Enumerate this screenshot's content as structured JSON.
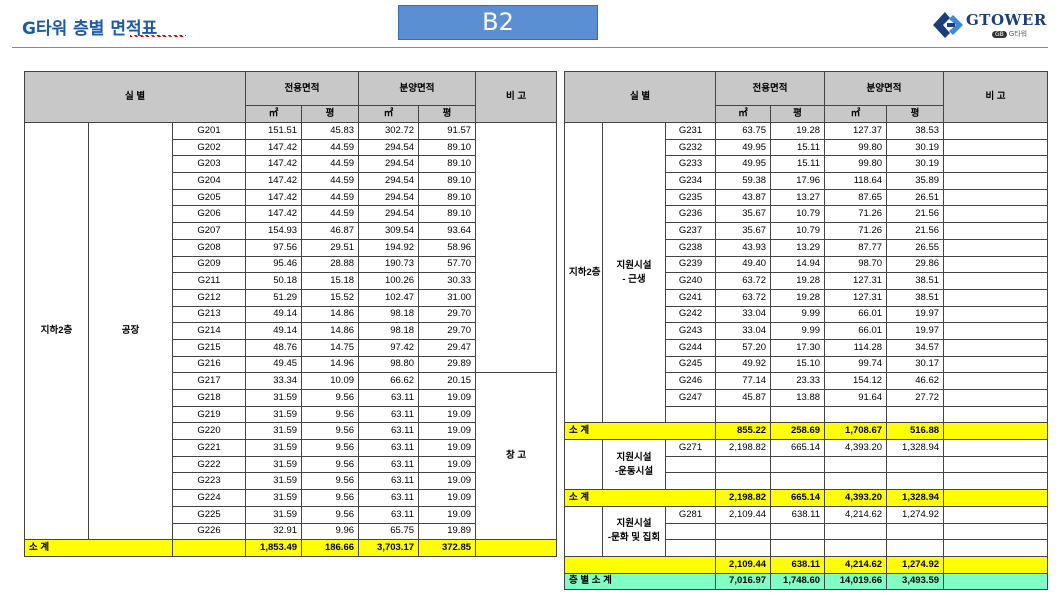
{
  "header": {
    "title": "G타워 층별 면적표",
    "floor_badge": "B2",
    "logo_text": "GTOWER",
    "logo_sub_badge": "GB",
    "logo_sub": "G타워"
  },
  "left_table": {
    "headers": {
      "room": "실        별",
      "exclusive": "전용면적",
      "sale": "분양면적",
      "note": "비  고",
      "sqm": "㎡",
      "pyeong": "평",
      "sqm2": "㎡",
      "pyeong2": "평"
    },
    "floor_label": "지하2층",
    "group_label": "공장",
    "note_storage": "창  고",
    "rows": [
      {
        "code": "G201",
        "ex_m2": "151.51",
        "ex_py": "45.83",
        "sa_m2": "302.72",
        "sa_py": "91.57"
      },
      {
        "code": "G202",
        "ex_m2": "147.42",
        "ex_py": "44.59",
        "sa_m2": "294.54",
        "sa_py": "89.10"
      },
      {
        "code": "G203",
        "ex_m2": "147.42",
        "ex_py": "44.59",
        "sa_m2": "294.54",
        "sa_py": "89.10"
      },
      {
        "code": "G204",
        "ex_m2": "147.42",
        "ex_py": "44.59",
        "sa_m2": "294.54",
        "sa_py": "89.10"
      },
      {
        "code": "G205",
        "ex_m2": "147.42",
        "ex_py": "44.59",
        "sa_m2": "294.54",
        "sa_py": "89.10"
      },
      {
        "code": "G206",
        "ex_m2": "147.42",
        "ex_py": "44.59",
        "sa_m2": "294.54",
        "sa_py": "89.10"
      },
      {
        "code": "G207",
        "ex_m2": "154.93",
        "ex_py": "46.87",
        "sa_m2": "309.54",
        "sa_py": "93.64"
      },
      {
        "code": "G208",
        "ex_m2": "97.56",
        "ex_py": "29.51",
        "sa_m2": "194.92",
        "sa_py": "58.96"
      },
      {
        "code": "G209",
        "ex_m2": "95.46",
        "ex_py": "28.88",
        "sa_m2": "190.73",
        "sa_py": "57.70"
      },
      {
        "code": "G211",
        "ex_m2": "50.18",
        "ex_py": "15.18",
        "sa_m2": "100.26",
        "sa_py": "30.33"
      },
      {
        "code": "G212",
        "ex_m2": "51.29",
        "ex_py": "15.52",
        "sa_m2": "102.47",
        "sa_py": "31.00"
      },
      {
        "code": "G213",
        "ex_m2": "49.14",
        "ex_py": "14.86",
        "sa_m2": "98.18",
        "sa_py": "29.70"
      },
      {
        "code": "G214",
        "ex_m2": "49.14",
        "ex_py": "14.86",
        "sa_m2": "98.18",
        "sa_py": "29.70"
      },
      {
        "code": "G215",
        "ex_m2": "48.76",
        "ex_py": "14.75",
        "sa_m2": "97.42",
        "sa_py": "29.47"
      },
      {
        "code": "G216",
        "ex_m2": "49.45",
        "ex_py": "14.96",
        "sa_m2": "98.80",
        "sa_py": "29.89"
      },
      {
        "code": "G217",
        "ex_m2": "33.34",
        "ex_py": "10.09",
        "sa_m2": "66.62",
        "sa_py": "20.15"
      },
      {
        "code": "G218",
        "ex_m2": "31.59",
        "ex_py": "9.56",
        "sa_m2": "63.11",
        "sa_py": "19.09"
      },
      {
        "code": "G219",
        "ex_m2": "31.59",
        "ex_py": "9.56",
        "sa_m2": "63.11",
        "sa_py": "19.09"
      },
      {
        "code": "G220",
        "ex_m2": "31.59",
        "ex_py": "9.56",
        "sa_m2": "63.11",
        "sa_py": "19.09"
      },
      {
        "code": "G221",
        "ex_m2": "31.59",
        "ex_py": "9.56",
        "sa_m2": "63.11",
        "sa_py": "19.09"
      },
      {
        "code": "G222",
        "ex_m2": "31.59",
        "ex_py": "9.56",
        "sa_m2": "63.11",
        "sa_py": "19.09"
      },
      {
        "code": "G223",
        "ex_m2": "31.59",
        "ex_py": "9.56",
        "sa_m2": "63.11",
        "sa_py": "19.09"
      },
      {
        "code": "G224",
        "ex_m2": "31.59",
        "ex_py": "9.56",
        "sa_m2": "63.11",
        "sa_py": "19.09"
      },
      {
        "code": "G225",
        "ex_m2": "31.59",
        "ex_py": "9.56",
        "sa_m2": "63.11",
        "sa_py": "19.09"
      },
      {
        "code": "G226",
        "ex_m2": "32.91",
        "ex_py": "9.96",
        "sa_m2": "65.75",
        "sa_py": "19.89"
      }
    ],
    "subtotal": {
      "label": "소  계",
      "ex_m2": "1,853.49",
      "ex_py": "186.66",
      "sa_m2": "3,703.17",
      "sa_py": "372.85"
    }
  },
  "right_table": {
    "headers": {
      "room": "실        별",
      "exclusive": "전용면적",
      "sale": "분양면적",
      "note": "비  고",
      "sqm": "㎡",
      "pyeong": "평",
      "sqm2": "㎡",
      "pyeong2": "평"
    },
    "floor_label": "지하2층",
    "group1_label": "지원시설\n- 근생",
    "group1_rows": [
      {
        "code": "G231",
        "ex_m2": "63.75",
        "ex_py": "19.28",
        "sa_m2": "127.37",
        "sa_py": "38.53"
      },
      {
        "code": "G232",
        "ex_m2": "49.95",
        "ex_py": "15.11",
        "sa_m2": "99.80",
        "sa_py": "30.19"
      },
      {
        "code": "G233",
        "ex_m2": "49.95",
        "ex_py": "15.11",
        "sa_m2": "99.80",
        "sa_py": "30.19"
      },
      {
        "code": "G234",
        "ex_m2": "59.38",
        "ex_py": "17.96",
        "sa_m2": "118.64",
        "sa_py": "35.89"
      },
      {
        "code": "G235",
        "ex_m2": "43.87",
        "ex_py": "13.27",
        "sa_m2": "87.65",
        "sa_py": "26.51"
      },
      {
        "code": "G236",
        "ex_m2": "35.67",
        "ex_py": "10.79",
        "sa_m2": "71.26",
        "sa_py": "21.56"
      },
      {
        "code": "G237",
        "ex_m2": "35.67",
        "ex_py": "10.79",
        "sa_m2": "71.26",
        "sa_py": "21.56"
      },
      {
        "code": "G238",
        "ex_m2": "43.93",
        "ex_py": "13.29",
        "sa_m2": "87.77",
        "sa_py": "26.55"
      },
      {
        "code": "G239",
        "ex_m2": "49.40",
        "ex_py": "14.94",
        "sa_m2": "98.70",
        "sa_py": "29.86"
      },
      {
        "code": "G240",
        "ex_m2": "63.72",
        "ex_py": "19.28",
        "sa_m2": "127.31",
        "sa_py": "38.51"
      },
      {
        "code": "G241",
        "ex_m2": "63.72",
        "ex_py": "19.28",
        "sa_m2": "127.31",
        "sa_py": "38.51"
      },
      {
        "code": "G242",
        "ex_m2": "33.04",
        "ex_py": "9.99",
        "sa_m2": "66.01",
        "sa_py": "19.97"
      },
      {
        "code": "G243",
        "ex_m2": "33.04",
        "ex_py": "9.99",
        "sa_m2": "66.01",
        "sa_py": "19.97"
      },
      {
        "code": "G244",
        "ex_m2": "57.20",
        "ex_py": "17.30",
        "sa_m2": "114.28",
        "sa_py": "34.57"
      },
      {
        "code": "G245",
        "ex_m2": "49.92",
        "ex_py": "15.10",
        "sa_m2": "99.74",
        "sa_py": "30.17"
      },
      {
        "code": "G246",
        "ex_m2": "77.14",
        "ex_py": "23.33",
        "sa_m2": "154.12",
        "sa_py": "46.62"
      },
      {
        "code": "G247",
        "ex_m2": "45.87",
        "ex_py": "13.88",
        "sa_m2": "91.64",
        "sa_py": "27.72"
      }
    ],
    "subtotal1": {
      "label": "소  계",
      "ex_m2": "855.22",
      "ex_py": "258.69",
      "sa_m2": "1,708.67",
      "sa_py": "516.88"
    },
    "group2_label": "지원시설\n-운동시설",
    "group2_row": {
      "code": "G271",
      "ex_m2": "2,198.82",
      "ex_py": "665.14",
      "sa_m2": "4,393.20",
      "sa_py": "1,328.94"
    },
    "subtotal2": {
      "label": "소  계",
      "ex_m2": "2,198.82",
      "ex_py": "665.14",
      "sa_m2": "4,393.20",
      "sa_py": "1,328.94"
    },
    "group3_label": "지원시설\n-문화 및 집회",
    "group3_row": {
      "code": "G281",
      "ex_m2": "2,109.44",
      "ex_py": "638.11",
      "sa_m2": "4,214.62",
      "sa_py": "1,274.92"
    },
    "subtotal3": {
      "label": "",
      "ex_m2": "2,109.44",
      "ex_py": "638.11",
      "sa_m2": "4,214.62",
      "sa_py": "1,274.92"
    },
    "total": {
      "label": "층 별 소 계",
      "ex_m2": "7,016.97",
      "ex_py": "1,748.60",
      "sa_m2": "14,019.66",
      "sa_py": "3,493.59"
    }
  },
  "colors": {
    "title": "#1b5bab",
    "badge": "#5b8fd4",
    "subtotal": "#ffff00",
    "total": "#7fffc4",
    "header": "#c8c8c8"
  }
}
